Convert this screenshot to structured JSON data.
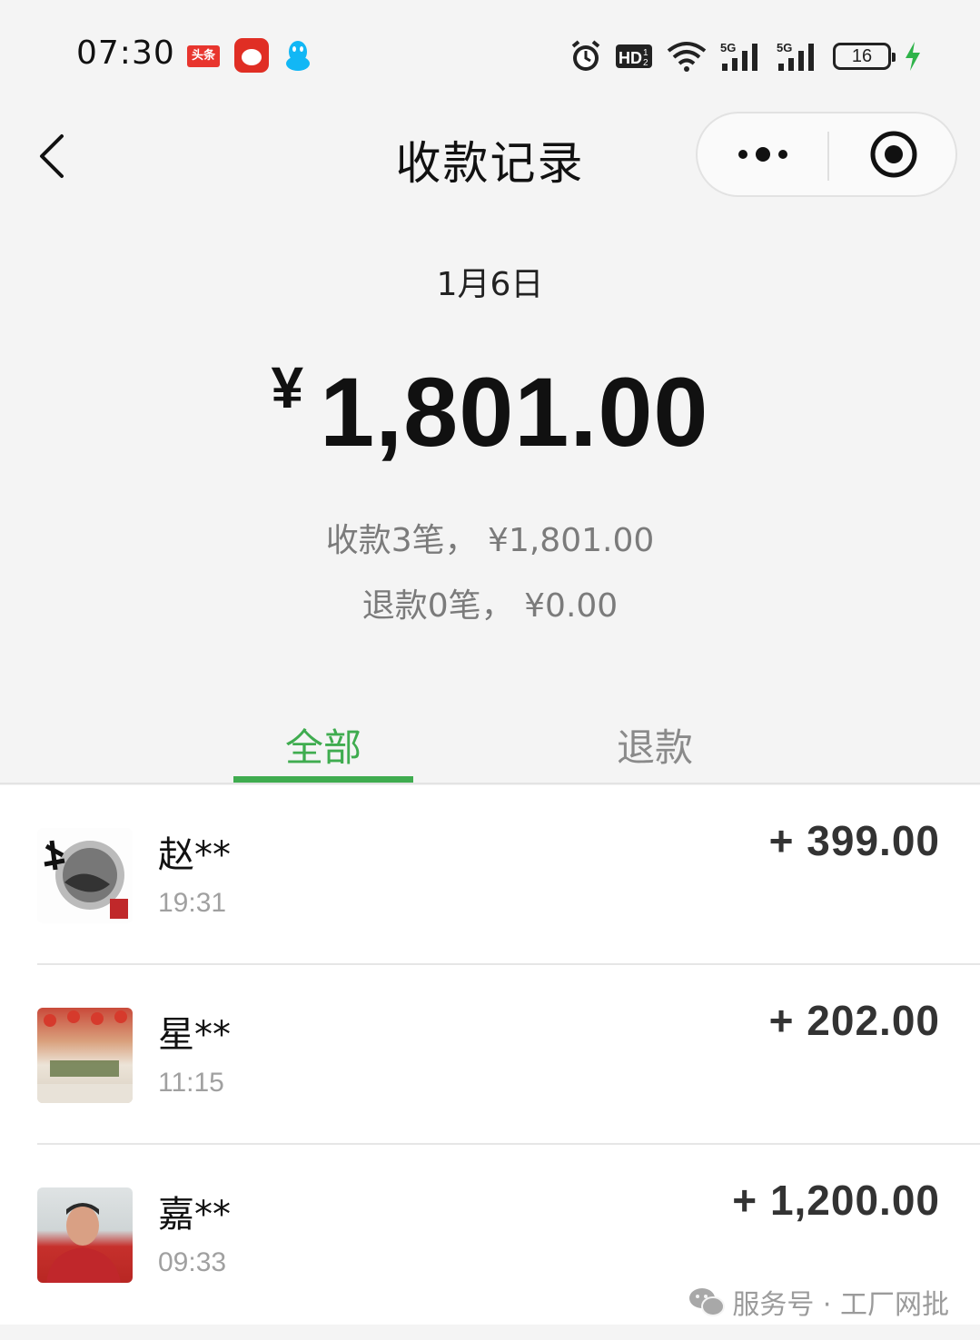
{
  "status_bar": {
    "time": "07:30",
    "toutiao_label": "头条",
    "battery_level": "16",
    "icons": [
      "toutiao-icon",
      "pinduoduo-icon",
      "qq-icon",
      "alarm-icon",
      "hd-icon",
      "wifi-icon",
      "signal-5g-icon",
      "signal-5g-icon",
      "battery-icon",
      "charging-icon"
    ]
  },
  "nav": {
    "title": "收款记录",
    "back_icon": "chevron-left-icon",
    "more_icon": "more-dots-icon",
    "close_icon": "target-close-icon"
  },
  "summary": {
    "date": "1月6日",
    "currency_symbol": "¥",
    "total": "1,801.00",
    "received_line": "收款3笔， ¥1,801.00",
    "refund_line": "退款0笔， ¥0.00"
  },
  "tabs": [
    {
      "label": "全部",
      "active": true
    },
    {
      "label": "退款",
      "active": false
    }
  ],
  "records": [
    {
      "name": "赵**",
      "time": "19:31",
      "amount": "+ 399.00",
      "avatar": "calligraphy-avatar"
    },
    {
      "name": "星**",
      "time": "11:15",
      "amount": "+ 202.00",
      "avatar": "shop-sign-avatar"
    },
    {
      "name": "嘉**",
      "time": "09:33",
      "amount": "+ 1,200.00",
      "avatar": "portrait-avatar"
    }
  ],
  "watermark": {
    "text": "服务号 · 工厂网批"
  },
  "colors": {
    "accent_green": "#3fac4f",
    "background": "#f4f4f4",
    "muted_text": "#7b7b7b"
  }
}
